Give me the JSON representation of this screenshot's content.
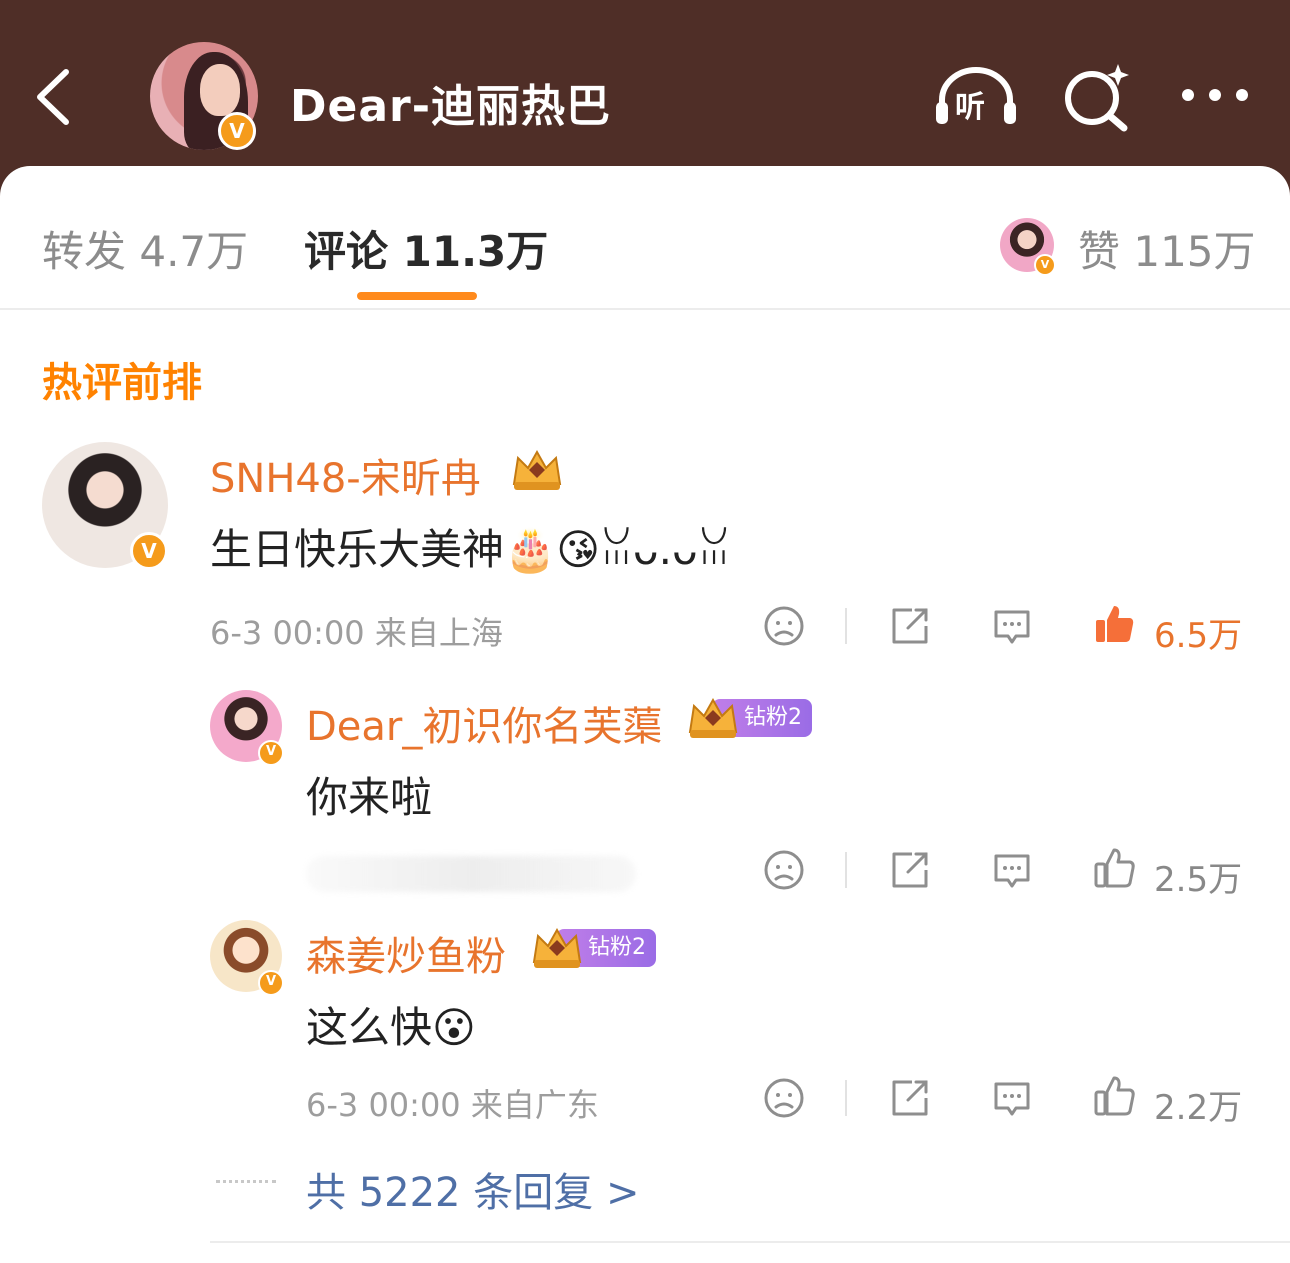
{
  "header": {
    "title": "Dear-迪丽热巴",
    "listen_label": "听",
    "verified_mark": "V",
    "icons": [
      "chevron-left-icon",
      "headphones-icon",
      "sparkle-search-icon",
      "more-dots-icon"
    ]
  },
  "tabs": {
    "repost": "转发 4.7万",
    "comments": "评论 11.3万",
    "likes": "赞 115万"
  },
  "section_title": "热评前排",
  "comments": [
    {
      "user": "SNH48-宋昕冉",
      "text": "生日快乐大美神🎂😘ꈍᴗ.ᴗꈍ",
      "meta": "6-3 00:00  来自上海",
      "likes": "6.5万",
      "liked": true
    }
  ],
  "replies": [
    {
      "user": "Dear_初识你名芙蕖",
      "badge": "钻粉2",
      "text": "你来啦",
      "likes": "2.5万"
    },
    {
      "user": "森姜炒鱼粉",
      "badge": "钻粉2",
      "text": "这么快😮",
      "meta": "6-3 00:00  来自广东",
      "likes": "2.2万"
    }
  ],
  "replies_link": "共 5222 条回复 >",
  "colors": {
    "header_bg": "#4f2e27",
    "accent_orange": "#ff8200",
    "username": "#e8742d",
    "link_blue": "#4f6fa6",
    "fan_badge": "#a872e6"
  }
}
